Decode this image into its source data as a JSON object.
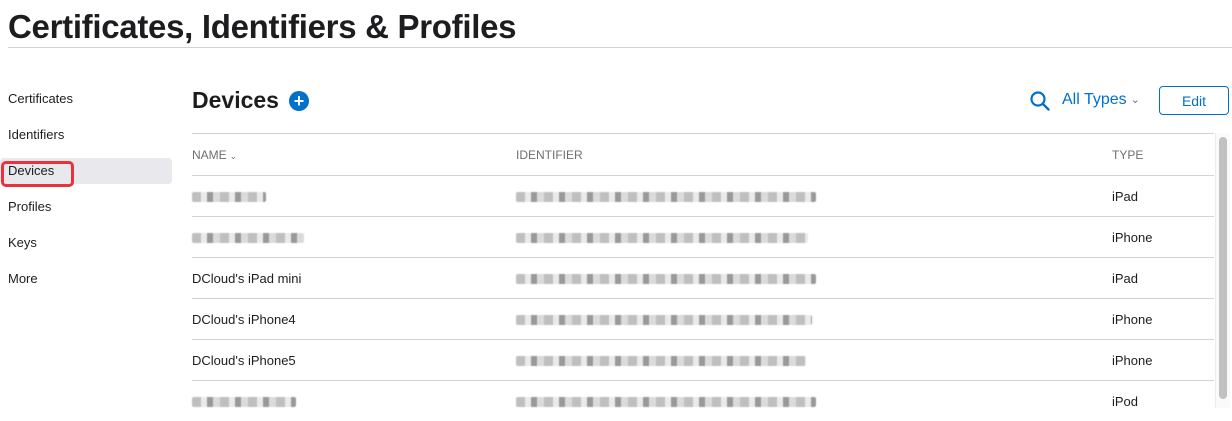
{
  "page": {
    "title": "Certificates, Identifiers & Profiles"
  },
  "sidebar": {
    "items": [
      {
        "label": "Certificates"
      },
      {
        "label": "Identifiers"
      },
      {
        "label": "Devices",
        "active": true
      },
      {
        "label": "Profiles"
      },
      {
        "label": "Keys"
      },
      {
        "label": "More"
      }
    ]
  },
  "main": {
    "section_title": "Devices",
    "add_symbol": "+",
    "filter_label": "All Types",
    "edit_label": "Edit"
  },
  "table": {
    "columns": {
      "name": "NAME",
      "identifier": "IDENTIFIER",
      "type": "TYPE"
    },
    "rows": [
      {
        "name": "",
        "identifier": "",
        "type": "iPad"
      },
      {
        "name": "",
        "identifier": "",
        "type": "iPhone"
      },
      {
        "name": "DCloud's iPad mini",
        "identifier": "",
        "type": "iPad"
      },
      {
        "name": "DCloud's iPhone4",
        "identifier": "",
        "type": "iPhone"
      },
      {
        "name": "DCloud's iPhone5",
        "identifier": "",
        "type": "iPhone"
      },
      {
        "name": "",
        "identifier": "",
        "type": "iPod"
      }
    ]
  },
  "icons": {
    "search": "search-icon",
    "add": "plus-circle-icon",
    "chevron": "chevron-down-icon"
  },
  "colors": {
    "accent": "#0070c9",
    "highlight": "#e8323c"
  }
}
